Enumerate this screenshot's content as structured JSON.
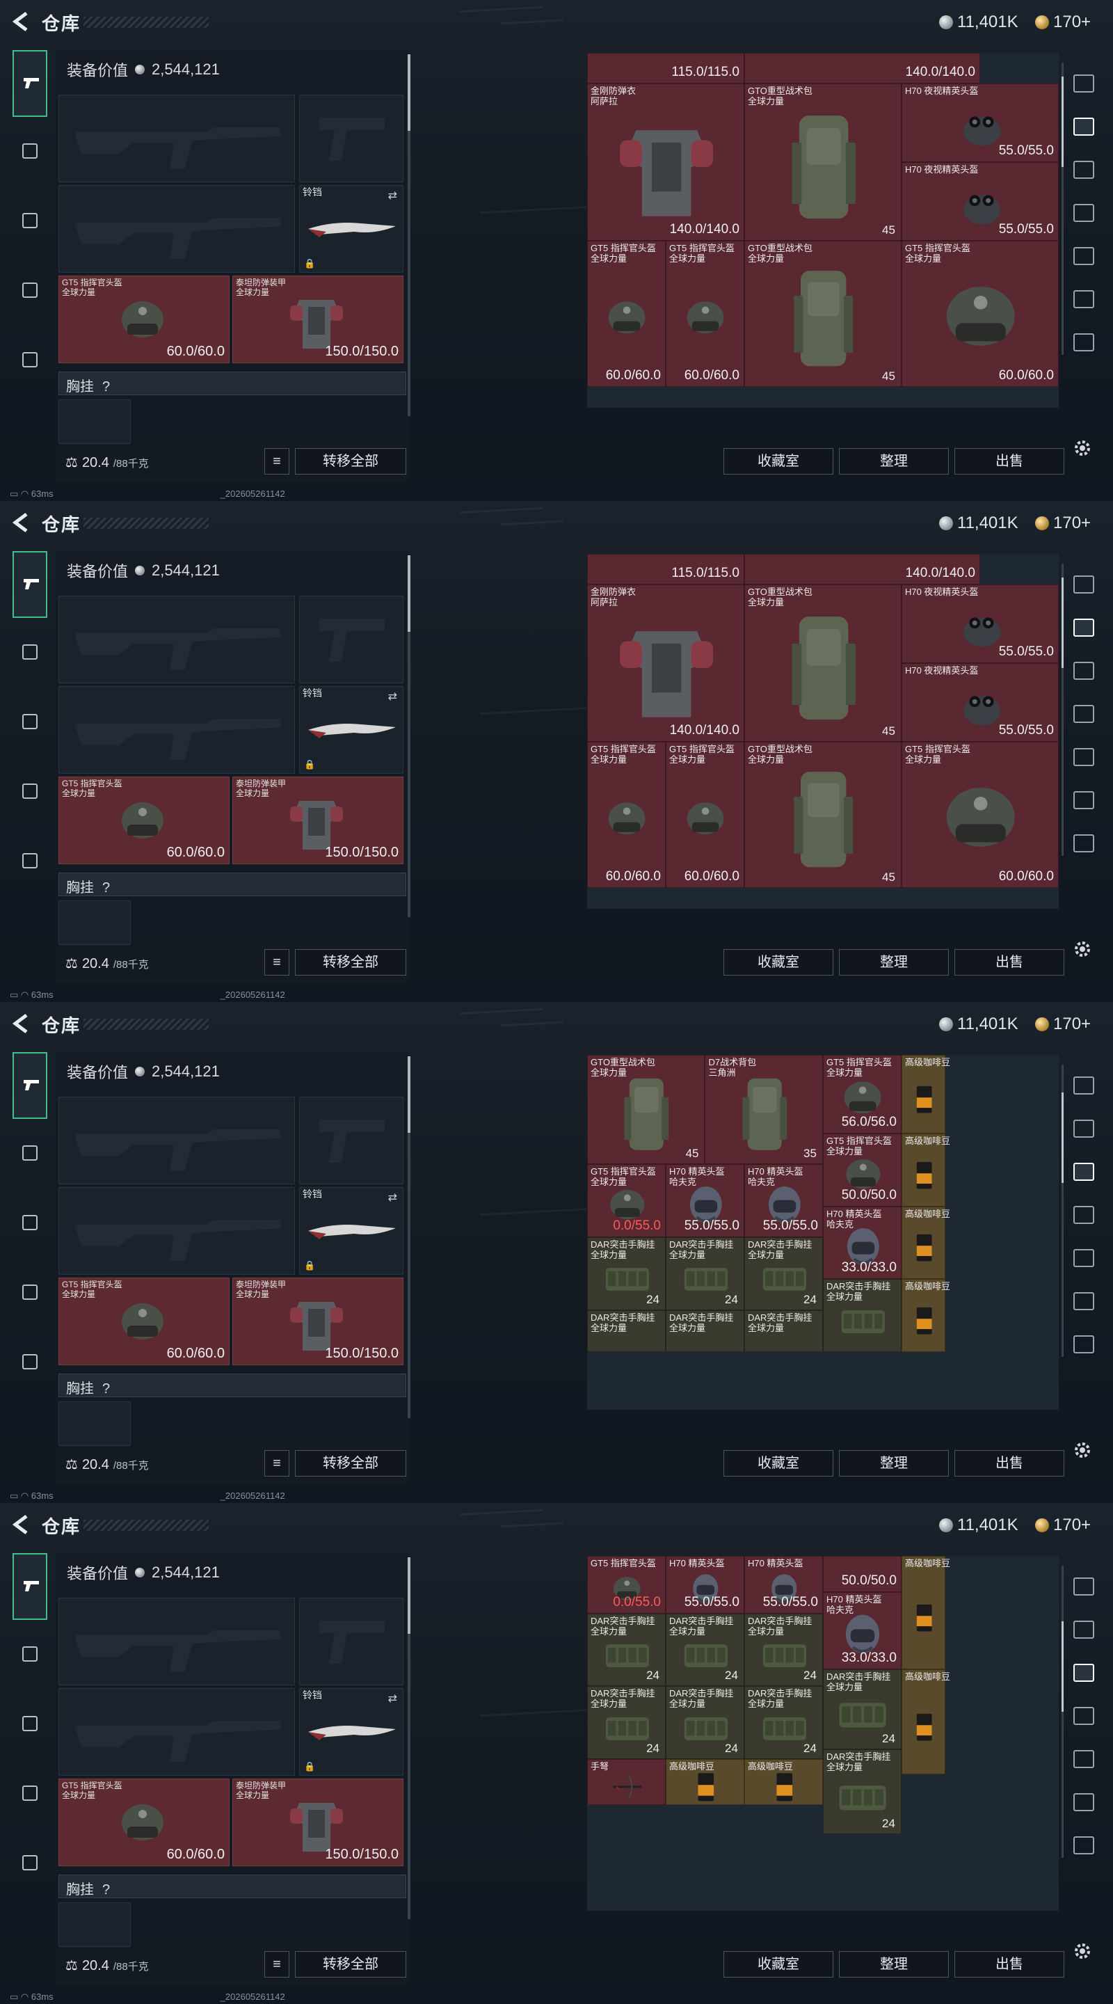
{
  "header": {
    "title": "仓库",
    "silver_value": "11,401K",
    "gold_value": "170+"
  },
  "loadout": {
    "equip_value_label": "装备价值",
    "equip_value": "2,544,121",
    "melee_label": "铃铛",
    "helmet_name": "GT5 指挥官头盔",
    "helmet_sub": "全球力量",
    "helmet_dur": "60.0/60.0",
    "armor_name": "泰坦防弹装甲",
    "armor_sub": "全球力量",
    "armor_dur": "150.0/150.0",
    "chest_label": "胸挂",
    "chest_help": "?",
    "weight": "20.4",
    "weight_max": "/88千克",
    "transfer_all": "转移全部"
  },
  "actions": {
    "collection": "收藏室",
    "sort": "整理",
    "sell": "出售"
  },
  "status": {
    "ping": "63ms",
    "build": "_202605261142"
  },
  "panels": [
    {
      "cells": [
        {
          "name": "",
          "dur": "115.0/115.0"
        },
        {
          "name": "",
          "dur": "140.0/140.0"
        },
        {
          "name": "金刚防弹衣\n阿萨拉",
          "dur": "140.0/140.0"
        },
        {
          "name": "GTO重型战术包\n全球力量",
          "dur": "45"
        },
        {
          "name": "H70 夜视精英头盔",
          "dur": "55.0/55.0"
        },
        {
          "name": "H70 夜视精英头盔",
          "dur": "55.0/55.0"
        },
        {
          "name": "GTO重型战术包\n全球力量",
          "dur": "45"
        },
        {
          "name": "GT5 指挥官头盔\n全球力量",
          "dur": "60.0/60.0"
        },
        {
          "name": "GT5 指挥官头盔\n全球力量",
          "dur": "60.0/60.0"
        },
        {
          "name": "GT5 指挥官头盔\n全球力量",
          "dur": "60.0/60.0"
        }
      ]
    },
    {
      "cells": [
        {
          "name": "",
          "dur": "115.0/115.0"
        },
        {
          "name": "",
          "dur": "140.0/140.0"
        },
        {
          "name": "金刚防弹衣\n阿萨拉",
          "dur": "140.0/140.0"
        },
        {
          "name": "GTO重型战术包\n全球力量",
          "dur": "45"
        },
        {
          "name": "H70 夜视精英头盔",
          "dur": "55.0/55.0"
        },
        {
          "name": "H70 夜视精英头盔",
          "dur": "55.0/55.0"
        },
        {
          "name": "GTO重型战术包\n全球力量",
          "dur": "45"
        },
        {
          "name": "GT5 指挥官头盔\n全球力量",
          "dur": "60.0/60.0"
        },
        {
          "name": "GT5 指挥官头盔\n全球力量",
          "dur": "60.0/60.0"
        },
        {
          "name": "GT5 指挥官头盔\n全球力量",
          "dur": "60.0/60.0"
        }
      ]
    },
    {
      "cells": [
        {
          "name": "GTO重型战术包\n全球力量",
          "dur": "45"
        },
        {
          "name": "D7战术背包\n三角洲",
          "dur": "35"
        },
        {
          "name": "GT5 指挥官头盔\n全球力量",
          "dur": "56.0/56.0"
        },
        {
          "name": "高级咖啡豆",
          "dur": ""
        },
        {
          "name": "GT5 指挥官头盔\n全球力量",
          "dur": "50.0/50.0"
        },
        {
          "name": "高级咖啡豆",
          "dur": ""
        },
        {
          "name": "GT5 指挥官头盔\n全球力量",
          "dur": "0.0/55.0"
        },
        {
          "name": "H70 精英头盔\n哈夫克",
          "dur": "55.0/55.0"
        },
        {
          "name": "H70 精英头盔\n哈夫克",
          "dur": "55.0/55.0"
        },
        {
          "name": "H70 精英头盔\n哈夫克",
          "dur": "33.0/33.0"
        },
        {
          "name": "高级咖啡豆",
          "dur": ""
        },
        {
          "name": "DAR突击手胸挂\n全球力量",
          "dur": "24"
        },
        {
          "name": "DAR突击手胸挂\n全球力量",
          "dur": "24"
        },
        {
          "name": "DAR突击手胸挂\n全球力量",
          "dur": "24"
        },
        {
          "name": "DAR突击手胸挂\n全球力量",
          "dur": ""
        },
        {
          "name": "高级咖啡豆",
          "dur": ""
        },
        {
          "name": "DAR突击手胸挂\n全球力量",
          "dur": ""
        },
        {
          "name": "DAR突击手胸挂\n全球力量",
          "dur": ""
        },
        {
          "name": "DAR突击手胸挂\n全球力量",
          "dur": ""
        }
      ]
    },
    {
      "cells": [
        {
          "name": "GT5 指挥官头盔",
          "dur": "0.0/55.0"
        },
        {
          "name": "H70 精英头盔",
          "dur": "55.0/55.0"
        },
        {
          "name": "H70 精英头盔",
          "dur": "55.0/55.0"
        },
        {
          "name": "",
          "dur": "50.0/50.0"
        },
        {
          "name": "H70 精英头盔\n哈夫克",
          "dur": "33.0/33.0"
        },
        {
          "name": "高级咖啡豆",
          "dur": ""
        },
        {
          "name": "DAR突击手胸挂\n全球力量",
          "dur": "24"
        },
        {
          "name": "DAR突击手胸挂\n全球力量",
          "dur": "24"
        },
        {
          "name": "DAR突击手胸挂\n全球力量",
          "dur": "24"
        },
        {
          "name": "DAR突击手胸挂\n全球力量",
          "dur": "24"
        },
        {
          "name": "DAR突击手胸挂\n全球力量",
          "dur": "24"
        },
        {
          "name": "DAR突击手胸挂\n全球力量",
          "dur": "24"
        },
        {
          "name": "DAR突击手胸挂\n全球力量",
          "dur": "24"
        },
        {
          "name": "DAR突击手胸挂\n全球力量",
          "dur": "24"
        },
        {
          "name": "高级咖啡豆",
          "dur": ""
        },
        {
          "name": "手弩",
          "dur": ""
        },
        {
          "name": "高级咖啡豆",
          "dur": ""
        },
        {
          "name": "高级咖啡豆",
          "dur": ""
        }
      ]
    }
  ]
}
